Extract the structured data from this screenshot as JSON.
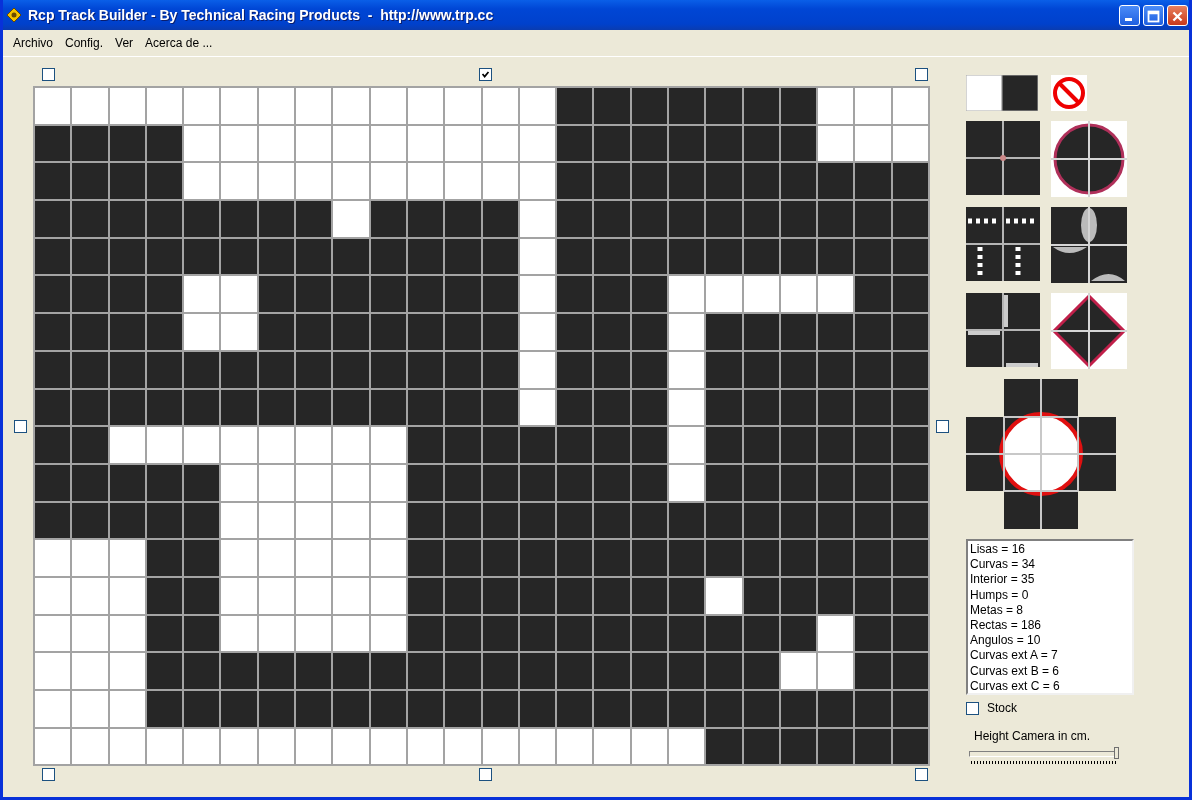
{
  "window": {
    "title": "Rcp Track Builder - By Technical Racing Products  -  http://www.trp.cc"
  },
  "menu": [
    "Archivo",
    "Config.",
    "Ver",
    "Acerca de ..."
  ],
  "edge_checkboxes": [
    {
      "checked": false
    },
    {
      "checked": true
    },
    {
      "checked": false
    },
    {
      "checked": false
    },
    {
      "checked": false
    },
    {
      "checked": false
    },
    {
      "checked": false
    },
    {
      "checked": false
    }
  ],
  "track": {
    "rows": [
      [
        false,
        false,
        false,
        false,
        false,
        false,
        false,
        false,
        false,
        false,
        false,
        false,
        false,
        false,
        true,
        true,
        true,
        true,
        true,
        true,
        true,
        false,
        false,
        false
      ],
      [
        true,
        true,
        true,
        true,
        false,
        false,
        false,
        false,
        false,
        false,
        false,
        false,
        false,
        false,
        true,
        true,
        true,
        true,
        true,
        true,
        true,
        false,
        false,
        false
      ],
      [
        true,
        true,
        true,
        true,
        false,
        false,
        false,
        false,
        false,
        false,
        false,
        false,
        false,
        false,
        true,
        true,
        true,
        true,
        true,
        true,
        true,
        true,
        true,
        true
      ],
      [
        true,
        true,
        true,
        true,
        true,
        true,
        true,
        true,
        false,
        true,
        true,
        true,
        true,
        false,
        true,
        true,
        true,
        true,
        true,
        true,
        true,
        true,
        true,
        true
      ],
      [
        true,
        true,
        true,
        true,
        true,
        true,
        true,
        true,
        true,
        true,
        true,
        true,
        true,
        false,
        true,
        true,
        true,
        true,
        true,
        true,
        true,
        true,
        true,
        true
      ],
      [
        true,
        true,
        true,
        true,
        false,
        false,
        true,
        true,
        true,
        true,
        true,
        true,
        true,
        false,
        true,
        true,
        true,
        false,
        false,
        false,
        false,
        false,
        true,
        true
      ],
      [
        true,
        true,
        true,
        true,
        false,
        false,
        true,
        true,
        true,
        true,
        true,
        true,
        true,
        false,
        true,
        true,
        true,
        false,
        true,
        true,
        true,
        true,
        true,
        true
      ],
      [
        true,
        true,
        true,
        true,
        true,
        true,
        true,
        true,
        true,
        true,
        true,
        true,
        true,
        false,
        true,
        true,
        true,
        false,
        true,
        true,
        true,
        true,
        true,
        true
      ],
      [
        true,
        true,
        true,
        true,
        true,
        true,
        true,
        true,
        true,
        true,
        true,
        true,
        true,
        false,
        true,
        true,
        true,
        false,
        true,
        true,
        true,
        true,
        true,
        true
      ],
      [
        true,
        true,
        false,
        false,
        false,
        false,
        false,
        false,
        false,
        false,
        true,
        true,
        true,
        true,
        true,
        true,
        true,
        false,
        true,
        true,
        true,
        true,
        true,
        true
      ],
      [
        true,
        true,
        true,
        true,
        true,
        false,
        false,
        false,
        false,
        false,
        true,
        true,
        true,
        true,
        true,
        true,
        true,
        false,
        true,
        true,
        true,
        true,
        true,
        true
      ],
      [
        true,
        true,
        true,
        true,
        true,
        false,
        false,
        false,
        false,
        false,
        true,
        true,
        true,
        true,
        true,
        true,
        true,
        true,
        true,
        true,
        true,
        true,
        true,
        true
      ],
      [
        false,
        false,
        false,
        true,
        true,
        false,
        false,
        false,
        false,
        false,
        true,
        true,
        true,
        true,
        true,
        true,
        true,
        true,
        true,
        true,
        true,
        true,
        true,
        true
      ],
      [
        false,
        false,
        false,
        true,
        true,
        false,
        false,
        false,
        false,
        false,
        true,
        true,
        true,
        true,
        true,
        true,
        true,
        true,
        false,
        true,
        true,
        true,
        true,
        true
      ],
      [
        false,
        false,
        false,
        true,
        true,
        false,
        false,
        false,
        false,
        false,
        true,
        true,
        true,
        true,
        true,
        true,
        true,
        true,
        true,
        true,
        true,
        false,
        true,
        true
      ],
      [
        false,
        false,
        false,
        true,
        true,
        true,
        true,
        true,
        true,
        true,
        true,
        true,
        true,
        true,
        true,
        true,
        true,
        true,
        true,
        true,
        false,
        false,
        true,
        true
      ],
      [
        false,
        false,
        false,
        true,
        true,
        true,
        true,
        true,
        true,
        true,
        true,
        true,
        true,
        true,
        true,
        true,
        true,
        true,
        true,
        true,
        true,
        true,
        true,
        true
      ],
      [
        false,
        false,
        false,
        false,
        false,
        false,
        false,
        false,
        false,
        false,
        false,
        false,
        false,
        false,
        false,
        false,
        false,
        false,
        true,
        true,
        true,
        true,
        true,
        true
      ]
    ]
  },
  "stats": [
    "Lisas = 16",
    "Curvas = 34",
    "Interior = 35",
    "Humps = 0",
    "Metas = 8",
    "Rectas = 186",
    "Angulos = 10",
    "Curvas ext A = 7",
    "Curvas ext B = 6",
    "Curvas ext C = 6"
  ],
  "stock": {
    "label": "Stock",
    "checked": false
  },
  "camera": {
    "label": "Height Camera in cm.",
    "level": 1
  }
}
